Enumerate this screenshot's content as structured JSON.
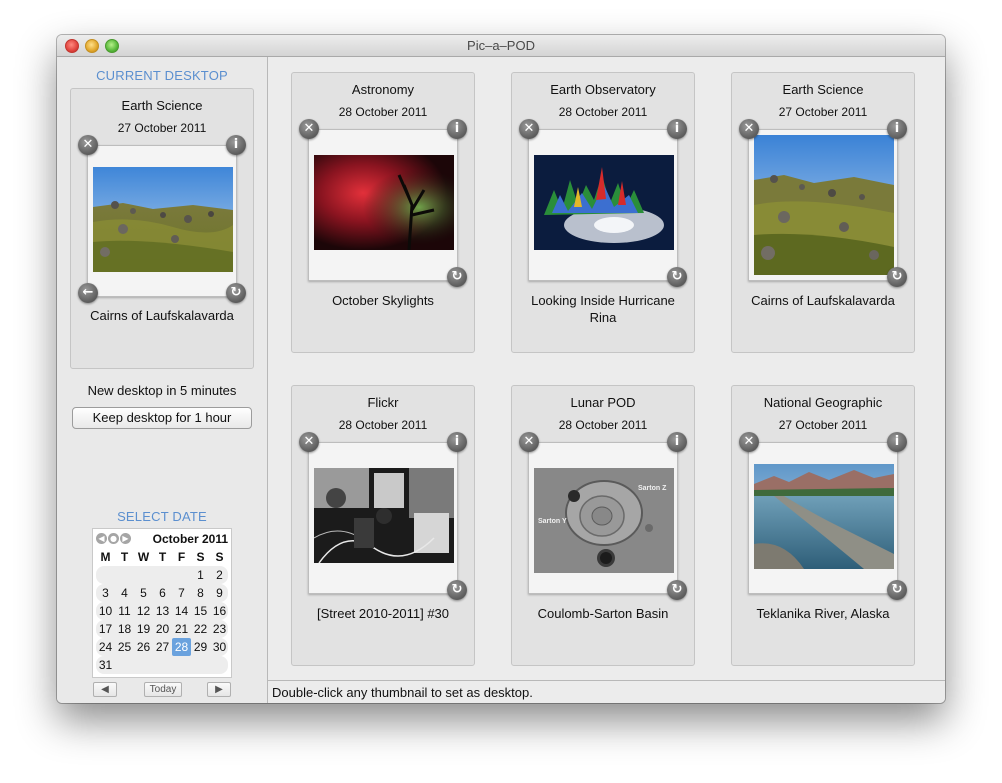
{
  "window": {
    "title": "Pic–a–POD"
  },
  "sidebar": {
    "current_heading": "CURRENT DESKTOP",
    "current": {
      "category": "Earth Science",
      "date": "27 October 2011",
      "caption": "Cairns of Laufskalavarda"
    },
    "new_desktop_text": "New desktop in 5 minutes",
    "keep_button": "Keep desktop for 1 hour",
    "select_heading": "SELECT DATE",
    "calendar": {
      "month": "October 2011",
      "weekdays": [
        "M",
        "T",
        "W",
        "T",
        "F",
        "S",
        "S"
      ],
      "weeks": [
        [
          "",
          "",
          "",
          "",
          "",
          "1",
          "2"
        ],
        [
          "3",
          "4",
          "5",
          "6",
          "7",
          "8",
          "9"
        ],
        [
          "10",
          "11",
          "12",
          "13",
          "14",
          "15",
          "16"
        ],
        [
          "17",
          "18",
          "19",
          "20",
          "21",
          "22",
          "23"
        ],
        [
          "24",
          "25",
          "26",
          "27",
          "28",
          "29",
          "30"
        ],
        [
          "31",
          "",
          "",
          "",
          "",
          "",
          ""
        ]
      ],
      "selected_day": "28",
      "today_button": "Today"
    }
  },
  "icons": {
    "close": "✕",
    "info": "i",
    "refresh": "↻",
    "back": "←",
    "prev": "◀",
    "next": "▶"
  },
  "cards": [
    {
      "category": "Astronomy",
      "date": "28 October 2011",
      "caption": "October Skylights",
      "image": "aurora-photo"
    },
    {
      "category": "Earth Observatory",
      "date": "28 October 2011",
      "caption": "Looking Inside Hurricane Rina",
      "image": "hurricane-photo"
    },
    {
      "category": "Earth Science",
      "date": "27 October 2011",
      "caption": "Cairns of Laufskalavarda",
      "image": "cairns-photo"
    },
    {
      "category": "Flickr",
      "date": "28 October 2011",
      "caption": "[Street 2010-2011] #30",
      "image": "street-photo"
    },
    {
      "category": "Lunar POD",
      "date": "28 October 2011",
      "caption": "Coulomb-Sarton Basin",
      "image": "lunar-photo",
      "labels": [
        "Sarton Z",
        "Sarton Y"
      ]
    },
    {
      "category": "National Geographic",
      "date": "27 October 2011",
      "caption": "Teklanika River, Alaska",
      "image": "river-photo"
    }
  ],
  "status": {
    "text": "Double-click any thumbnail to set as desktop."
  }
}
